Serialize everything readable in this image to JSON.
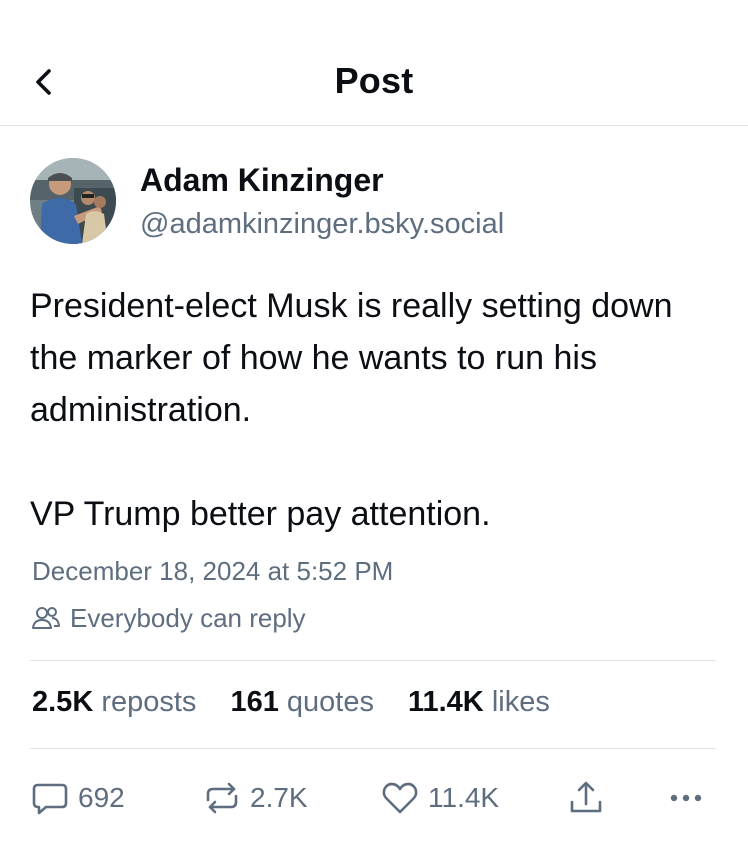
{
  "header": {
    "title": "Post"
  },
  "author": {
    "display_name": "Adam Kinzinger",
    "handle": "@adamkinzinger.bsky.social"
  },
  "post": {
    "text": "President-elect Musk is really setting down the marker of how he wants to run his administration.\n\nVP Trump better pay attention.",
    "timestamp": "December 18, 2024 at 5:52 PM",
    "reply_setting": "Everybody can reply"
  },
  "stats": {
    "reposts": {
      "count": "2.5K",
      "label": "reposts"
    },
    "quotes": {
      "count": "161",
      "label": "quotes"
    },
    "likes": {
      "count": "11.4K",
      "label": "likes"
    }
  },
  "actions": {
    "reply_count": "692",
    "repost_count": "2.7K",
    "like_count": "11.4K"
  },
  "icons": {
    "back": "chevron-left-icon",
    "people": "people-icon",
    "reply": "speech-bubble-icon",
    "repost": "repost-arrows-icon",
    "like": "heart-icon",
    "share": "share-upload-icon",
    "more": "ellipsis-icon"
  },
  "colors": {
    "text": "#0b0f14",
    "muted": "#5e6e7f",
    "divider": "#dfe4ea"
  }
}
